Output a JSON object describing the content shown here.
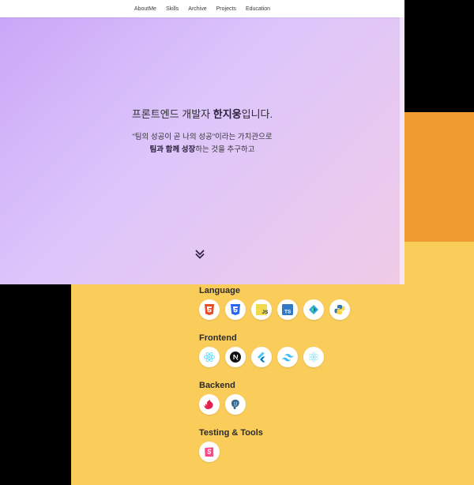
{
  "nav": {
    "items": [
      "AboutMe",
      "Skills",
      "Archive",
      "Projects",
      "Education"
    ]
  },
  "hero": {
    "title_prefix": "프론트엔드 개발자 ",
    "title_name": "한지웅",
    "title_suffix": "입니다.",
    "sub_line1": "\"팀의 성공이 곧 나의 성공\"이라는 가치관으로",
    "sub_line2_bold": "팀과 함께 성장",
    "sub_line2_rest": "하는 것을 추구하고",
    "scroll_icon": "double-chevron-down-icon"
  },
  "skills": {
    "groups": [
      {
        "title": "Language",
        "icons": [
          "html5-icon",
          "css3-icon",
          "javascript-icon",
          "typescript-icon",
          "azure-icon",
          "python-icon"
        ]
      },
      {
        "title": "Frontend",
        "icons": [
          "react-icon",
          "nextjs-icon",
          "flutter-icon",
          "tailwind-icon",
          "electron-icon"
        ]
      },
      {
        "title": "Backend",
        "icons": [
          "nestjs-icon",
          "postgresql-icon"
        ]
      },
      {
        "title": "Testing & Tools",
        "icons": [
          "storybook-icon"
        ]
      }
    ]
  },
  "colors": {
    "hero_gradient_start": "#c9a5f7",
    "hero_gradient_end": "#f0cbe7",
    "skills_bg": "#facd5b",
    "skills_band": "#ef9b32"
  }
}
